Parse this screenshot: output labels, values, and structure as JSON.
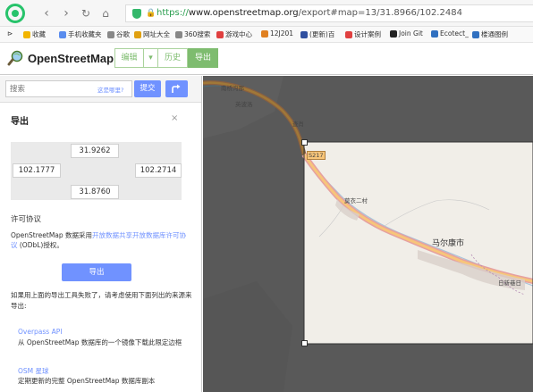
{
  "browser": {
    "url_scheme": "https://",
    "url_host": "www.openstreetmap.org",
    "url_path": "/export#map=13/31.8966/102.2484",
    "bookmarks": [
      {
        "label": "收藏",
        "icon": "star-icon",
        "color": "#f2b500"
      },
      {
        "label": "手机收藏夹",
        "icon": "phone-icon",
        "color": "#5a8dee"
      },
      {
        "label": "谷歌",
        "icon": "page-icon",
        "color": "#888888"
      },
      {
        "label": "网址大全",
        "icon": "globe-icon",
        "color": "#e0a010"
      },
      {
        "label": "360搜索",
        "icon": "page-icon",
        "color": "#888888"
      },
      {
        "label": "游戏中心",
        "icon": "game-icon",
        "color": "#e04040"
      },
      {
        "label": "12J201",
        "icon": "page-icon",
        "color": "#e08020"
      },
      {
        "label": "(更新)百",
        "icon": "page-icon",
        "color": "#3050a0"
      },
      {
        "label": "设计案例",
        "icon": "design-icon",
        "color": "#e04040"
      },
      {
        "label": "Join Git",
        "icon": "github-icon",
        "color": "#222222"
      },
      {
        "label": "Ecotect_",
        "icon": "gear-icon",
        "color": "#3070c0"
      },
      {
        "label": "楼通图例",
        "icon": "gear-icon",
        "color": "#3070c0"
      }
    ]
  },
  "header": {
    "site_name": "OpenStreetMap",
    "tabs": [
      {
        "label": "编辑",
        "active": false
      },
      {
        "label": "▾",
        "active": false
      },
      {
        "label": "历史",
        "active": false
      },
      {
        "label": "导出",
        "active": true
      }
    ]
  },
  "search": {
    "placeholder": "搜索",
    "where_link": "这是哪里?",
    "submit_label": "提交"
  },
  "export": {
    "title": "导出",
    "close": "×",
    "bbox": {
      "north": "31.9262",
      "west": "102.1777",
      "east": "102.2714",
      "south": "31.8760"
    },
    "license_heading": "许可协议",
    "license_prefix": "OpenStreetMap 数据采用",
    "license_link": "开放数据共享开放数据库许可协议",
    "license_suffix": " (ODbL)授权。",
    "button_label": "导出",
    "fallback_text": "如果用上面的导出工具失败了，请考虑使用下面列出的来源来导出:",
    "sources": [
      {
        "title": "Overpass API",
        "desc": "从 OpenStreetMap 数据库的一个镜像下载此限定边框"
      },
      {
        "title": "OSM 星球",
        "desc": "定期更新的完整 OpenStreetMap 数据库副本"
      }
    ]
  },
  "map": {
    "labels": [
      "南桥沟那",
      "英波洛",
      "查肖",
      "S217",
      "莫衣二村",
      "马尔康市",
      "日新巷日"
    ]
  }
}
